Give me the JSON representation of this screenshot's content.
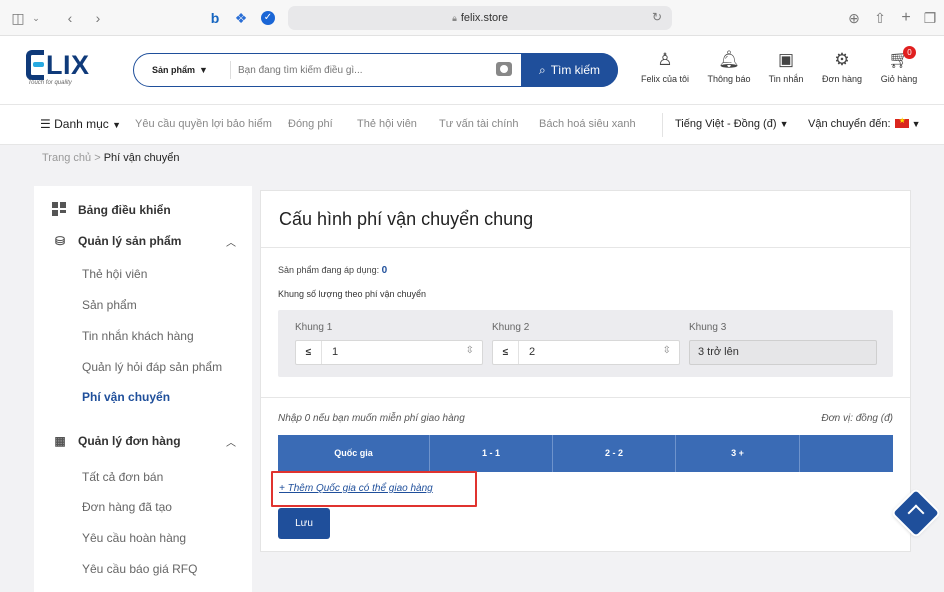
{
  "browser": {
    "url": "felix.store"
  },
  "header": {
    "logo_word": "LIX",
    "logo_tagline": "Touch for quality",
    "search_category": "Sản phẩm",
    "search_placeholder": "Bạn đang tìm kiếm điều gì...",
    "search_button": "Tìm kiếm",
    "icons": [
      {
        "label": "Felix của tôi"
      },
      {
        "label": "Thông báo"
      },
      {
        "label": "Tin nhắn"
      },
      {
        "label": "Đơn hàng"
      },
      {
        "label": "Giỏ hàng",
        "badge": "0"
      }
    ]
  },
  "nav": {
    "menu": "Danh mục",
    "items": [
      "Yêu cầu quyền lợi bảo hiểm",
      "Đóng phí",
      "Thẻ hội viên",
      "Tư vấn tài chính",
      "Bách hoá siêu xanh"
    ],
    "language": "Tiếng Việt - Đồng (đ)",
    "shipping": "Vận chuyển đến:"
  },
  "breadcrumb": {
    "home": "Trang chủ",
    "sep": ">",
    "current": "Phí vận chuyển"
  },
  "sidebar": {
    "dashboard": "Bảng điều khiển",
    "product_group": "Quản lý sản phẩm",
    "product_items": [
      "Thẻ hội viên",
      "Sản phẩm",
      "Tin nhắn khách hàng",
      "Quản lý hỏi đáp sản phẩm",
      "Phí vận chuyển"
    ],
    "order_group": "Quản lý đơn hàng",
    "order_items": [
      "Tất cả đơn bán",
      "Đơn hàng đã tạo",
      "Yêu cầu hoàn hàng",
      "Yêu cầu báo giá RFQ"
    ]
  },
  "main": {
    "title": "Cấu hình phí vận chuyển chung",
    "applied_label": "Sản phẩm đang áp dụng:",
    "applied_count": "0",
    "tiers_title": "Khung số lượng theo phí vận chuyển",
    "tiers": [
      {
        "label": "Khung 1",
        "op": "≤",
        "value": "1"
      },
      {
        "label": "Khung 2",
        "op": "≤",
        "value": "2"
      },
      {
        "label": "Khung 3",
        "value": "3 trở lên"
      }
    ],
    "free_note": "Nhập 0 nếu bạn muốn miễn phí giao hàng",
    "unit": "Đơn vị: đồng (đ)",
    "table_headers": [
      "Quốc gia",
      "1 - 1",
      "2 - 2",
      "3 +",
      ""
    ],
    "add_link": "+ Thêm Quốc gia có thể giao hàng",
    "save": "Lưu"
  }
}
